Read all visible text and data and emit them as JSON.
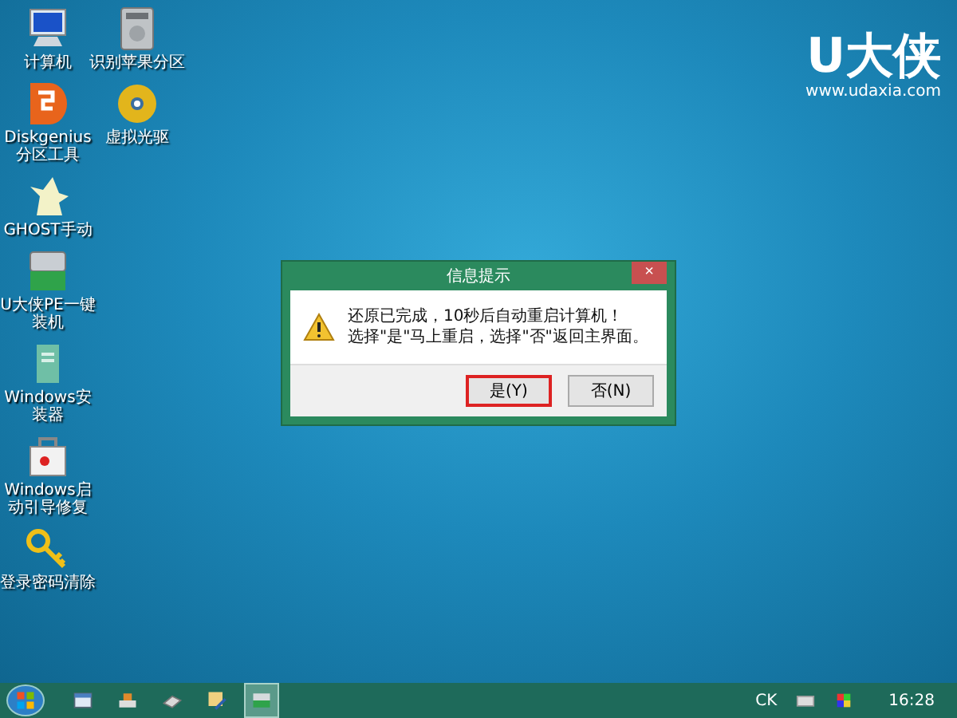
{
  "desktop_icon_rows": [
    {
      "icons": [
        {
          "kind": "computer",
          "label": [
            "计算机"
          ]
        },
        {
          "kind": "drive",
          "label": [
            "识别苹果分区"
          ]
        }
      ]
    },
    {
      "icons": [
        {
          "kind": "diskgenius",
          "label": [
            "Diskgenius",
            "分区工具"
          ]
        },
        {
          "kind": "disc",
          "label": [
            "虚拟光驱"
          ]
        }
      ]
    },
    {
      "icons": [
        {
          "kind": "ghost",
          "label": [
            "GHOST手动"
          ]
        }
      ]
    },
    {
      "icons": [
        {
          "kind": "usb",
          "label": [
            "U大侠PE一键",
            "装机"
          ]
        }
      ]
    },
    {
      "icons": [
        {
          "kind": "installer",
          "label": [
            "Windows安",
            "装器"
          ]
        }
      ]
    },
    {
      "icons": [
        {
          "kind": "toolbox",
          "label": [
            "Windows启",
            "动引导修复"
          ]
        }
      ]
    },
    {
      "icons": [
        {
          "kind": "key",
          "label": [
            "登录密码清除"
          ]
        }
      ]
    }
  ],
  "logo": {
    "brand": "U大侠",
    "url": "www.udaxia.com"
  },
  "dialog": {
    "title": "信息提示",
    "close": "×",
    "message": [
      "还原已完成，10秒后自动重启计算机！",
      "选择\"是\"马上重启，选择\"否\"返回主界面。"
    ],
    "buttons": [
      {
        "label": "是(Y)",
        "selected": true
      },
      {
        "label": "否(N)",
        "selected": false
      }
    ]
  },
  "taskbar": {
    "apps": [
      {
        "kind": "window",
        "active": false
      },
      {
        "kind": "tools",
        "active": false
      },
      {
        "kind": "drive",
        "active": false
      },
      {
        "kind": "brush",
        "active": false
      },
      {
        "kind": "usb",
        "active": true
      }
    ],
    "tray": {
      "language": "CK",
      "clock": "16:28"
    }
  }
}
